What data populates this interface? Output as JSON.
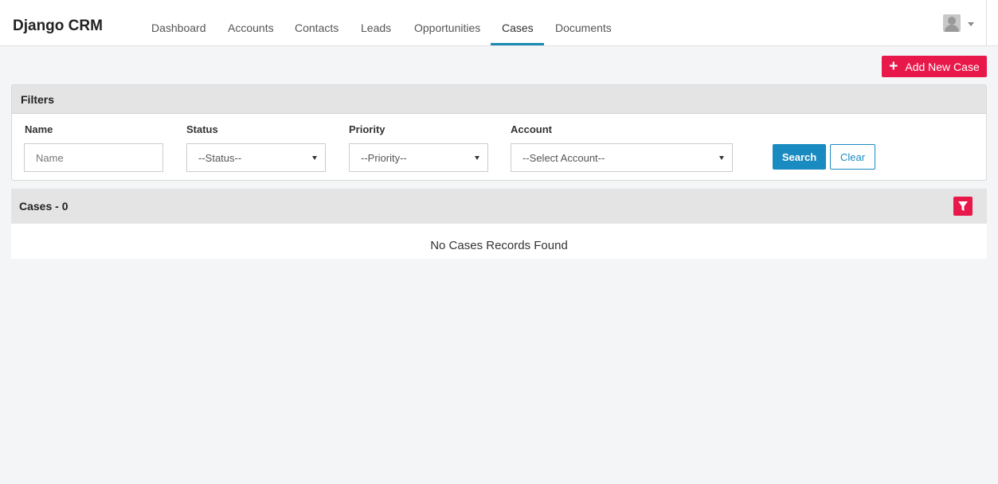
{
  "navbar": {
    "brand": "Django CRM",
    "items": [
      {
        "label": "Dashboard"
      },
      {
        "label": "Accounts"
      },
      {
        "label": "Contacts"
      },
      {
        "label": "Leads"
      },
      {
        "label": "Opportunities"
      },
      {
        "label": "Cases",
        "active": true
      },
      {
        "label": "Documents"
      }
    ],
    "user_icon": "user-avatar-icon",
    "menu_icon": "caret-down-icon"
  },
  "actions": {
    "add_label": "Add New Case",
    "add_icon": "plus-icon"
  },
  "filters": {
    "title": "Filters",
    "name_label": "Name",
    "name_placeholder": "Name",
    "status_label": "Status",
    "status_value": "--Status--",
    "priority_label": "Priority",
    "priority_value": "--Priority--",
    "account_label": "Account",
    "account_value": "--Select Account--",
    "search_label": "Search",
    "clear_label": "Clear"
  },
  "cases": {
    "title": "Cases - 0",
    "empty_message": "No Cases Records Found",
    "filter_icon": "funnel-icon"
  },
  "colors": {
    "accent_red": "#e8184a",
    "accent_blue": "#1a8bc0",
    "nav_underline": "#1a8bb3"
  }
}
